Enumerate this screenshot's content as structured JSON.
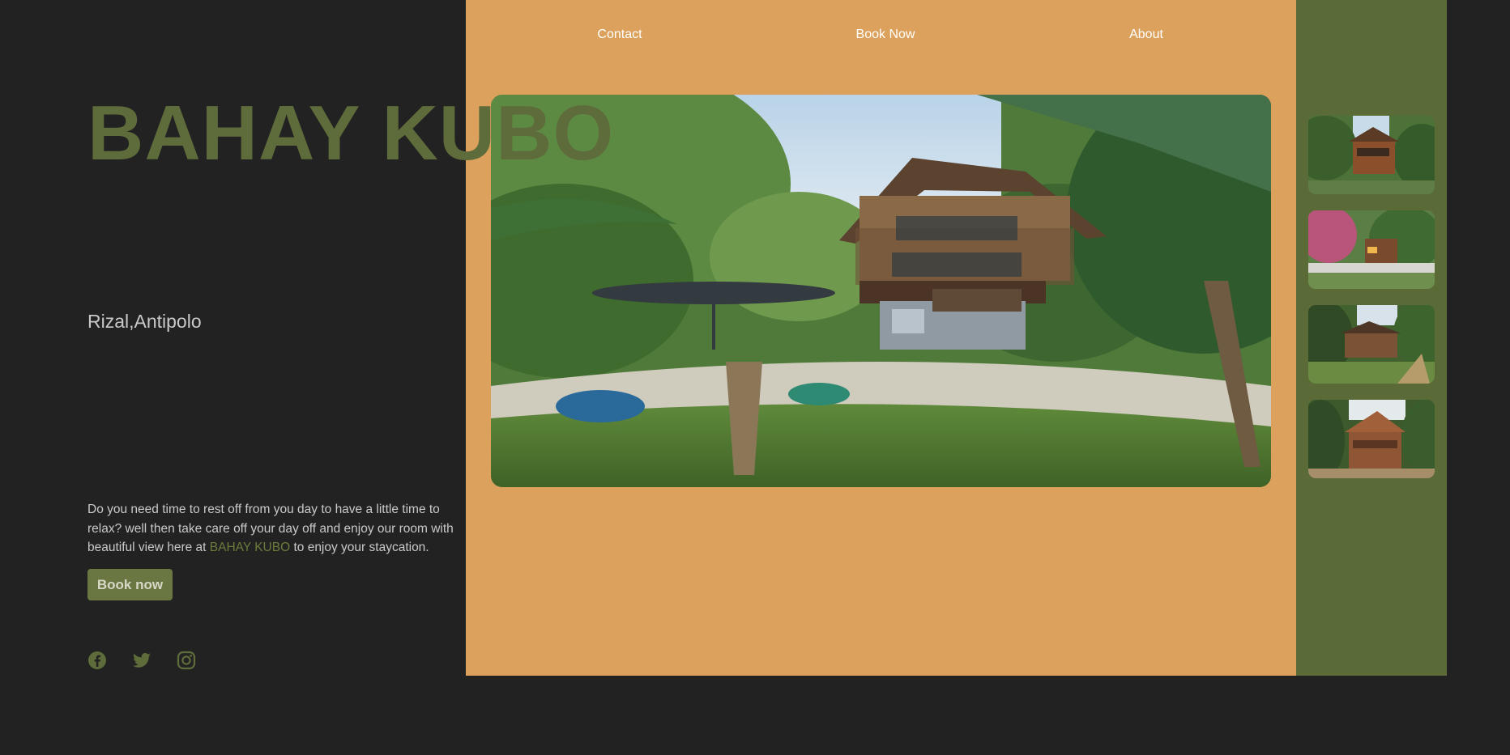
{
  "brand": {
    "title": "BAHAY KUBO",
    "location": "Rizal,Antipolo"
  },
  "description": {
    "before": "Do you need time to rest off from you day to have a little time to relax? well then take care off your day off and enjoy our room with beautiful view here at ",
    "brand": "BAHAY KUBO",
    "after": " to enjoy your staycation."
  },
  "cta": {
    "label": "Book now"
  },
  "nav": {
    "contact": "Contact",
    "book_now": "Book Now",
    "about": "About"
  },
  "social": [
    "facebook-icon",
    "twitter-icon",
    "instagram-icon"
  ],
  "colors": {
    "background": "#222222",
    "center_panel": "#dca15c",
    "right_panel": "#5a6b38",
    "accent_green": "#5e6b3a"
  }
}
